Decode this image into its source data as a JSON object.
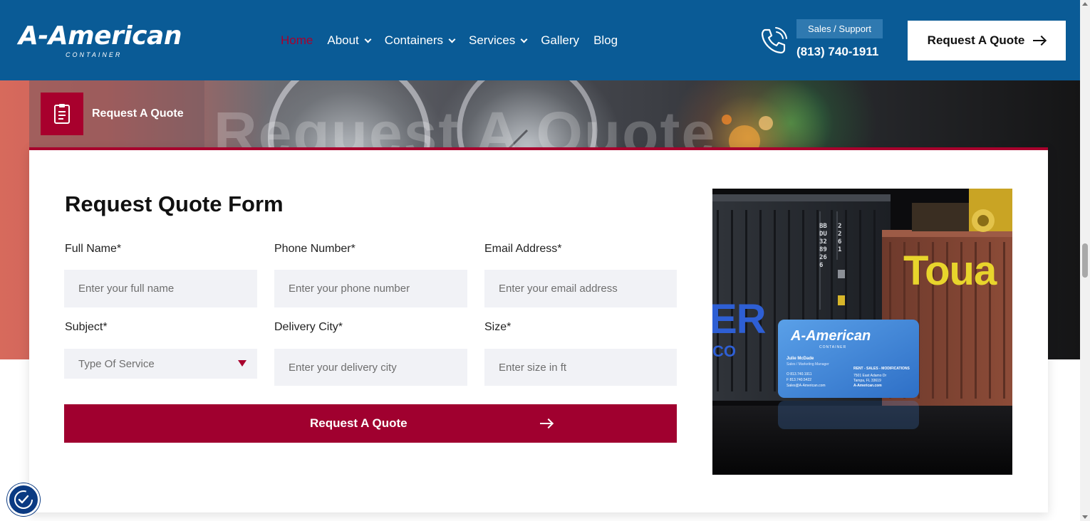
{
  "brand": {
    "logo_text": "A-American",
    "logo_sub": "CONTAINER",
    "header_bg": "#0a5b96",
    "accent": "#a8002d"
  },
  "nav": {
    "items": [
      {
        "label": "Home",
        "active": true,
        "has_dropdown": false
      },
      {
        "label": "About",
        "active": false,
        "has_dropdown": true
      },
      {
        "label": "Containers",
        "active": false,
        "has_dropdown": true
      },
      {
        "label": "Services",
        "active": false,
        "has_dropdown": true
      },
      {
        "label": "Gallery",
        "active": false,
        "has_dropdown": false
      },
      {
        "label": "Blog",
        "active": false,
        "has_dropdown": false
      }
    ]
  },
  "contact": {
    "badge": "Sales / Support",
    "phone": "(813) 740-1911"
  },
  "header_cta": {
    "label": "Request A Quote"
  },
  "hero": {
    "watermark": "Request A Quote",
    "breadcrumb": "Request A Quote"
  },
  "form": {
    "title": "Request Quote Form",
    "fields": {
      "full_name": {
        "label": "Full Name*",
        "placeholder": "Enter your full name"
      },
      "phone": {
        "label": "Phone Number*",
        "placeholder": "Enter your phone number"
      },
      "email": {
        "label": "Email Address*",
        "placeholder": "Enter your email address"
      },
      "subject": {
        "label": "Subject*",
        "value": "Type Of Service"
      },
      "city": {
        "label": "Delivery City*",
        "placeholder": "Enter your delivery city"
      },
      "size": {
        "label": "Size*",
        "placeholder": "Enter size in ft"
      }
    },
    "submit_label": "Request A Quote"
  },
  "photo": {
    "card_logo": "A-American",
    "card_sub": "CONTAINER",
    "card_name": "Julie McDade",
    "card_role": "Sales / Marketing Manager",
    "card_phone_o": "O  813.740.1911",
    "card_phone_f": "F  813.740.5422",
    "card_email": "Sales@A-American.com",
    "card_services": "RENT - SALES - MODIFICATIONS",
    "card_address_1": "7501 East Adamo Dr",
    "card_address_2": "Tampa, FL 33619",
    "card_site": "A-American.com",
    "container_text_left": "ER",
    "container_text_left_sub": "CO",
    "container_brand_right": "Toua",
    "container_code_1": "BBDU 328926 6",
    "container_code_2": "2261"
  }
}
